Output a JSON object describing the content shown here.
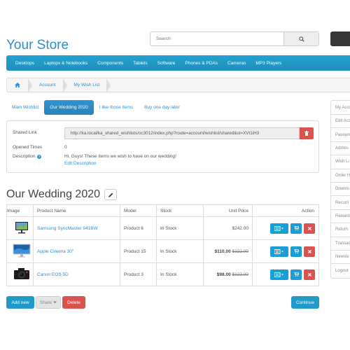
{
  "header": {
    "store_name": "Your Store",
    "search_placeholder": "Search"
  },
  "menu": [
    "Desktops",
    "Laptops & Notebooks",
    "Components",
    "Tablets",
    "Software",
    "Phones & PDAs",
    "Cameras",
    "MP3 Players"
  ],
  "breadcrumb": [
    "Account",
    "My Wish List"
  ],
  "tabs": [
    "Main Wishlist",
    "Our Wedding 2020",
    "I like those items",
    "Buy one day later"
  ],
  "active_tab": 1,
  "info": {
    "shared_link_label": "Shared Link",
    "shared_link_value": "http://ka.local/ka_shared_wishlists/oc3012/index.php?route=account/wishlist/shared&st=XVt1iH3",
    "opened_times_label": "Opened Times",
    "opened_times_value": "0",
    "description_label": "Description",
    "description_value": "Hi, Guys! These items we wish to have on our wedding!",
    "edit_description_link": "Edit Description"
  },
  "wishlist_title": "Our Wedding 2020",
  "table": {
    "headers": [
      "Image",
      "Product Name",
      "Model",
      "Stock",
      "Unit Price",
      "Action"
    ],
    "rows": [
      {
        "name": "Samsung SyncMaster 941BW",
        "model": "Product 6",
        "stock": "In Stock",
        "price": "$242.00",
        "special": "",
        "image": "monitor-icon"
      },
      {
        "name": "Apple Cinema 30\"",
        "model": "Product 15",
        "stock": "In Stock",
        "price": "$122.00",
        "special": "$110.00",
        "image": "cinema-display-icon"
      },
      {
        "name": "Canon EOS 5D",
        "model": "Product 3",
        "stock": "In Stock",
        "price": "$122.00",
        "special": "$98.00",
        "image": "camera-icon"
      }
    ]
  },
  "buttons": {
    "add_new": "Add new",
    "share": "Share",
    "delete": "Delete",
    "continue": "Continue"
  },
  "sidebar": [
    "My Acco",
    "Edit Acc",
    "Passwo",
    "Addres",
    "Wish Li",
    "Order H",
    "Downlo",
    "Recurri",
    "Reward",
    "Return",
    "Transac",
    "Newsle",
    "Logout"
  ],
  "colors": {
    "accent": "#229ac8",
    "link": "#2e8fcf",
    "danger": "#d9534f"
  }
}
